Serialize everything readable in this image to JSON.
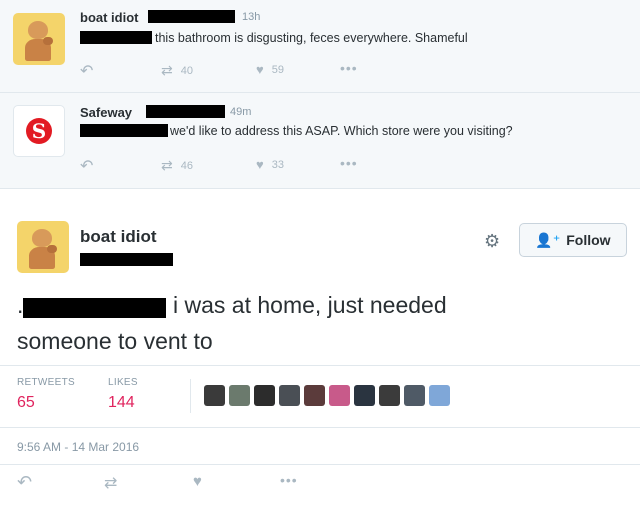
{
  "tweet1": {
    "name": "boat idiot",
    "time": "13h",
    "text": "this bathroom is disgusting, feces everywhere. Shameful",
    "retweets": "40",
    "likes": "59"
  },
  "tweet2": {
    "name": "Safeway",
    "time": "49m",
    "text": "we'd like to address this ASAP. Which store were you visiting?",
    "retweets": "46",
    "likes": "33"
  },
  "main": {
    "name": "boat idiot",
    "follow_label": "Follow",
    "text_line1_prefix": ".",
    "text_line1": "i was at home, just needed",
    "text_line2": "someone to vent to",
    "retweets_label": "RETWEETS",
    "retweets_value": "65",
    "likes_label": "LIKES",
    "likes_value": "144",
    "datetime": "9:56 AM - 14 Mar 2016"
  },
  "icons": {
    "reply": "reply-icon",
    "retweet": "retweet-icon",
    "like": "heart-icon",
    "more": "more-icon",
    "settings": "gear-icon",
    "follow": "person-add-icon"
  },
  "colors": {
    "accent": "#1da1f2",
    "like_red": "#e0245e",
    "muted": "#8899a6",
    "safeway_red": "#e21b23",
    "liker_avatars": [
      "#3a3a3a",
      "#6b7a6d",
      "#2c2c2c",
      "#4a4f55",
      "#5b3b3b",
      "#c85a8a",
      "#2a3440",
      "#3b3b3b",
      "#4f5a66",
      "#7fa7d8"
    ]
  }
}
